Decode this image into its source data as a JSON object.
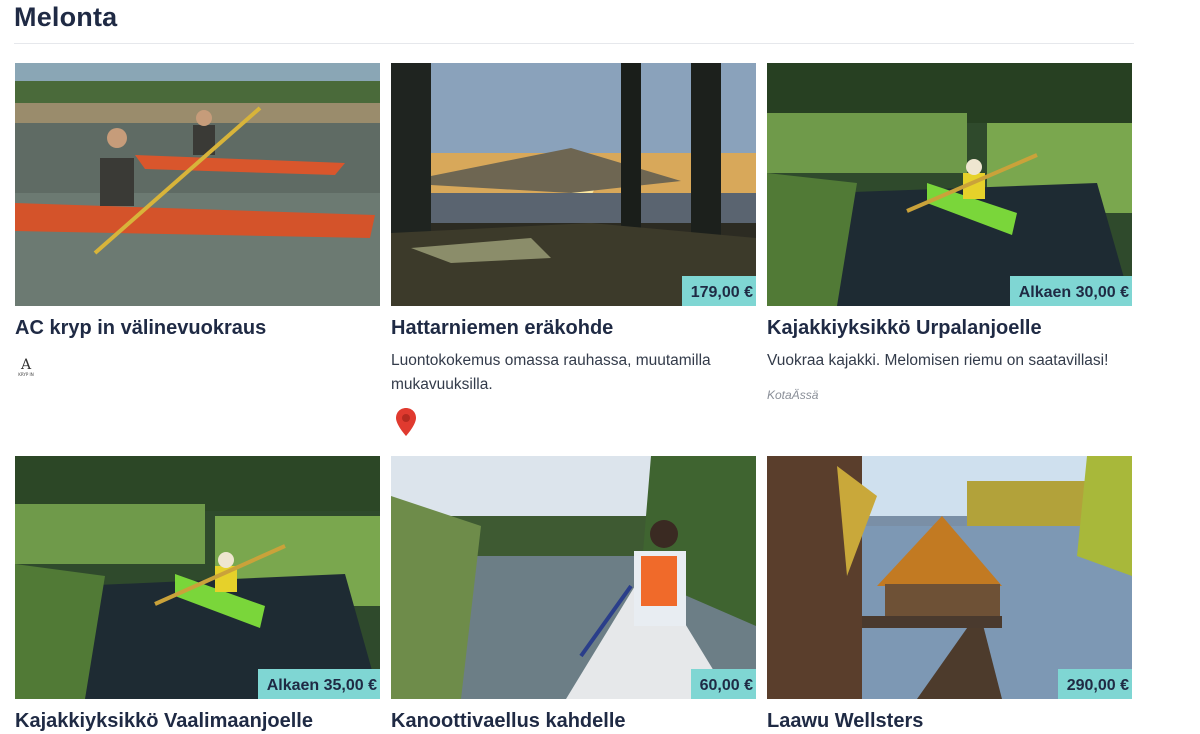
{
  "section": {
    "title": "Melonta"
  },
  "colors": {
    "price_badge": "#7fd6d3",
    "title_text": "#1f2a44",
    "pin_red": "#e03a2f"
  },
  "cards": [
    {
      "title": "AC kryp in välinevuokraus",
      "price": "",
      "description": "",
      "provider": "",
      "logo": "ac-kryp-logo",
      "logo_text": "KRYP IN"
    },
    {
      "title": "Hattarniemen eräkohde",
      "price": "179,00 €",
      "description": "Luontokokemus omassa rauhassa, muutamilla mukavuuksilla.",
      "provider": "",
      "icon": "map-pin-icon"
    },
    {
      "title": "Kajakkiyksikkö Urpalanjoelle",
      "price": "Alkaen 30,00 €",
      "description": "Vuokraa kajakki. Melomisen riemu on saatavillasi!",
      "provider": "KotaÄssä"
    },
    {
      "title": "Kajakkiyksikkö Vaalimaanjoelle",
      "price": "Alkaen 35,00 €",
      "description": "",
      "provider": ""
    },
    {
      "title": "Kanoottivaellus kahdelle",
      "price": "60,00 €",
      "description": "",
      "provider": ""
    },
    {
      "title": "Laawu Wellsters",
      "price": "290,00 €",
      "description": "",
      "provider": ""
    }
  ]
}
